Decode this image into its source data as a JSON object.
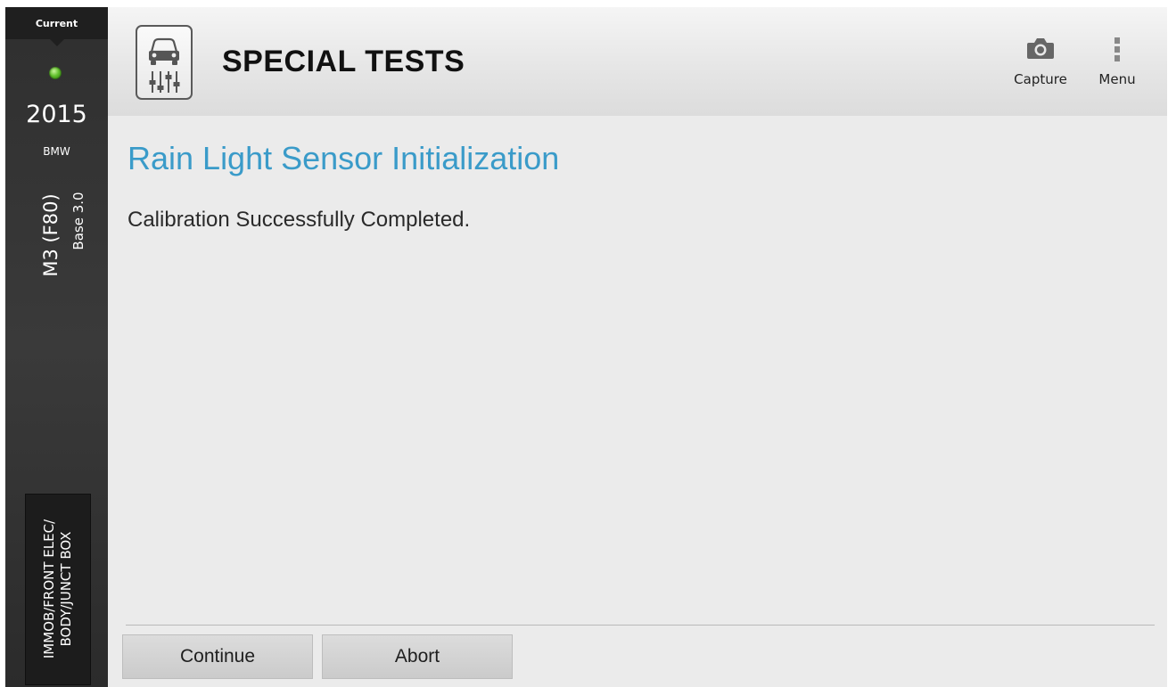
{
  "sidebar": {
    "current_label": "Current",
    "status_indicator": "green",
    "year": "2015",
    "make": "BMW",
    "model": "M3 (F80)",
    "engine": "Base 3.0",
    "system_lines": [
      "IMMOB/FRONT ELEC/",
      "BODY/JUNCT BOX"
    ]
  },
  "header": {
    "app_icon": "car-adjust-icon",
    "title": "SPECIAL TESTS",
    "capture_label": "Capture",
    "capture_icon": "camera-icon",
    "menu_label": "Menu",
    "menu_icon": "vertical-dots-icon"
  },
  "main": {
    "test_title": "Rain Light Sensor Initialization",
    "message": "Calibration Successfully Completed."
  },
  "footer": {
    "continue_label": "Continue",
    "abort_label": "Abort"
  },
  "colors": {
    "accent_title": "#3a9bc9",
    "status_led": "#5fbf2a",
    "sidebar_bg": "#333333"
  }
}
